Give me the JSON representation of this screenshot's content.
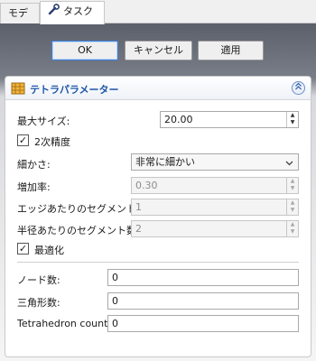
{
  "tabs": [
    {
      "label": "モデル"
    },
    {
      "label": "タスク"
    }
  ],
  "buttons": {
    "ok": "OK",
    "cancel": "キャンセル",
    "apply": "適用"
  },
  "panel": {
    "title": "テトラパラメーター",
    "max_size_label": "最大サイズ:",
    "max_size_value": "20.00",
    "second_order_label": "2次精度",
    "second_order_checked": true,
    "fineness_label": "細かさ:",
    "fineness_value": "非常に細かい",
    "growth_rate_label": "増加率:",
    "growth_rate_value": "0.30",
    "seg_per_edge_label": "エッジあたりのセグメント数",
    "seg_per_edge_value": "1",
    "seg_per_radius_label": "半径あたりのセグメント数",
    "seg_per_radius_value": "2",
    "optimize_label": "最適化",
    "optimize_checked": true,
    "nodes_label": "ノード数:",
    "nodes_value": "0",
    "triangles_label": "三角形数:",
    "triangles_value": "0",
    "tetra_label": "Tetrahedron count:",
    "tetra_value": "0"
  }
}
